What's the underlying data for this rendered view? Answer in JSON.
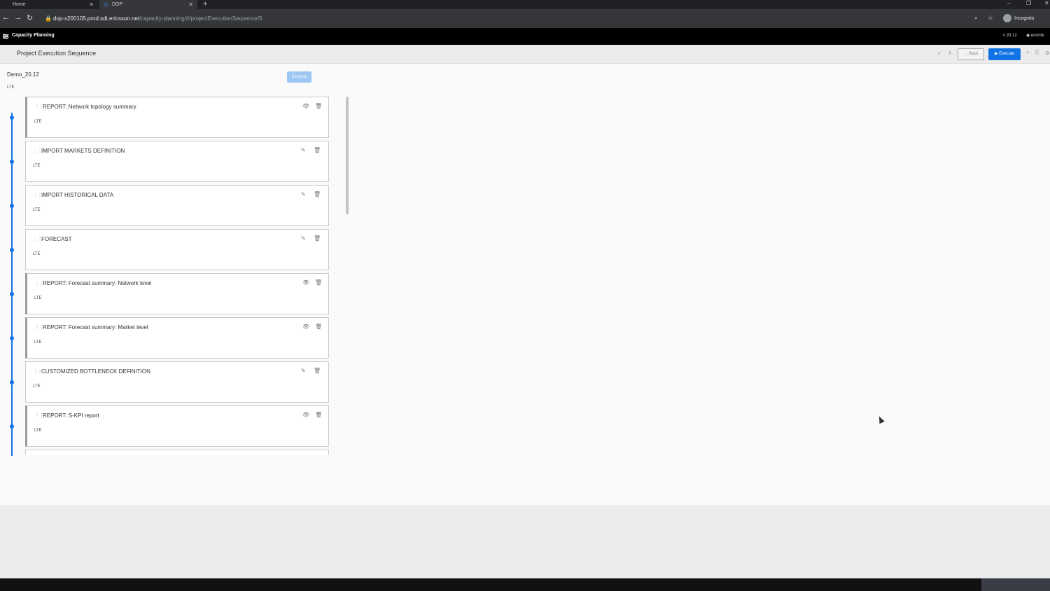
{
  "browser": {
    "tabs": [
      {
        "label": "Home"
      },
      {
        "label": "DOP"
      }
    ],
    "url_host": "dop-x200105.prod.sdt.ericsson.net",
    "url_path": "/capacity-planning/#/projectExecutionSequence/5",
    "profile": "Incognito"
  },
  "app": {
    "name": "Capacity Planning",
    "version": "v 20.12",
    "user": "eromfe"
  },
  "toolbar": {
    "title": "Project Execution Sequence",
    "back_label": "Back",
    "execute_label": "Execute"
  },
  "project": {
    "name": "Demo_20.12",
    "technology": "LTE",
    "execute_label": "Execute"
  },
  "steps": [
    {
      "title": "REPORT: Network topology summary",
      "tech": "LTE",
      "kind": "report"
    },
    {
      "title": "IMPORT MARKETS DEFINITION",
      "tech": "LTE",
      "kind": "task"
    },
    {
      "title": "IMPORT HISTORICAL DATA",
      "tech": "LTE",
      "kind": "task"
    },
    {
      "title": "FORECAST",
      "tech": "LTE",
      "kind": "task"
    },
    {
      "title": "REPORT: Forecast summary: Network level",
      "tech": "LTE",
      "kind": "report"
    },
    {
      "title": "REPORT: Forecast summary: Market level",
      "tech": "LTE",
      "kind": "report"
    },
    {
      "title": "CUSTOMIZED BOTTLENECK DEFINITION",
      "tech": "LTE",
      "kind": "task"
    },
    {
      "title": "REPORT: S-KPI report",
      "tech": "LTE",
      "kind": "report"
    }
  ],
  "colors": {
    "accent": "#1174e6",
    "appbar": "#000000"
  }
}
